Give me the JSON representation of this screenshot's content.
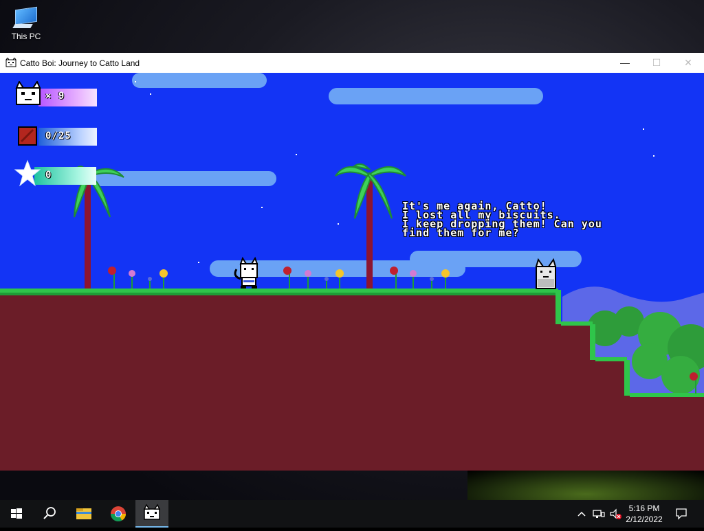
{
  "desktop": {
    "icon_label": "This PC"
  },
  "window": {
    "title": "Catto Boi: Journey to Catto Land",
    "minimize_glyph": "—",
    "maximize_glyph": "☐",
    "close_glyph": "✕"
  },
  "hud": {
    "lives": "× 9",
    "biscuits": "0/25",
    "stars": "0"
  },
  "dialog": {
    "lines": [
      "It's me again, Catto!",
      "I lost all my biscuits.",
      "I keep dropping them! Can you",
      "find them for me?"
    ]
  },
  "taskbar": {
    "time": "5:16 PM",
    "date": "2/12/2022",
    "items": [
      "start-icon",
      "search-icon",
      "file-explorer-icon",
      "chrome-icon",
      "catto-boi-app-icon"
    ]
  },
  "colors": {
    "sky": "#1334f5",
    "cloud": "#6aa2f5",
    "ground": "#6b1d28",
    "grass": "#2fc54a",
    "palm_leaf": "#3fd15a",
    "palm_trunk": "#8c1530"
  }
}
